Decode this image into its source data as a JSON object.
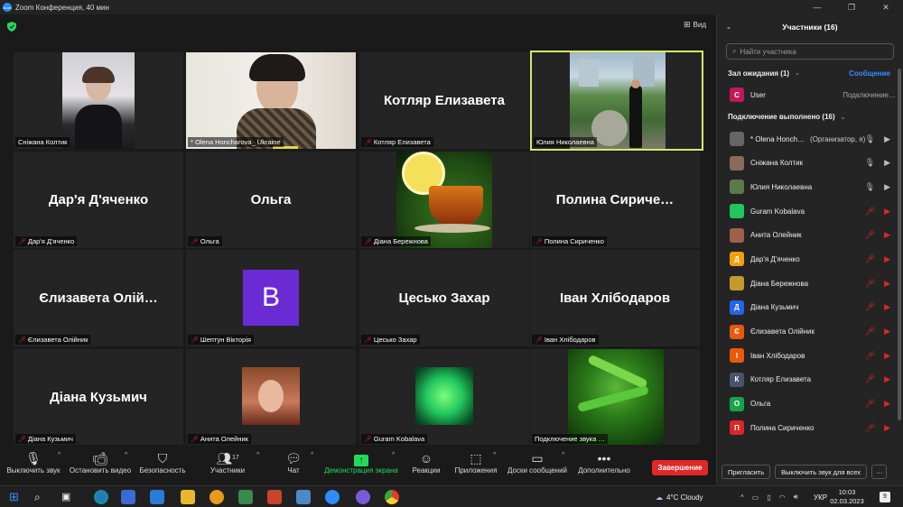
{
  "window": {
    "title": "Zoom Конференция, 40 мин"
  },
  "view_button": {
    "label": "Вид"
  },
  "tiles": [
    {
      "name": "Сніжана Колтик",
      "big": "",
      "muted": false
    },
    {
      "name": "* Olena Honcharova_ Ukraine",
      "big": "",
      "muted": false
    },
    {
      "name": "Котляр Елизавета",
      "big": "Котляр Елизавета",
      "muted": true
    },
    {
      "name": "Юлия Николаевна",
      "big": "",
      "muted": false
    },
    {
      "name": "Дар'я Д'яченко",
      "big": "Дар'я Д'яченко",
      "muted": true
    },
    {
      "name": "Ольга",
      "big": "Ольга",
      "muted": true
    },
    {
      "name": "Діана Бережнова",
      "big": "",
      "muted": true
    },
    {
      "name": "Полина Сириченко",
      "big": "Полина  Сириче…",
      "muted": true
    },
    {
      "name": "Єлизавета Олійник",
      "big": "Єлизавета  Олій…",
      "muted": true
    },
    {
      "name": "Шептун Вікторія",
      "big": "",
      "muted": true,
      "avatar_letter": "B"
    },
    {
      "name": "Цесько Захар",
      "big": "Цесько Захар",
      "muted": true
    },
    {
      "name": "Іван Хлібодаров",
      "big": "Іван Хлібодаров",
      "muted": true
    },
    {
      "name": "Діана Кузьмич",
      "big": "Діана Кузьмич",
      "muted": true
    },
    {
      "name": "Анита Олейник",
      "big": "",
      "muted": true
    },
    {
      "name": "Guram Kobalava",
      "big": "",
      "muted": true
    },
    {
      "name": "Подключение звука …",
      "big": "",
      "muted": false
    }
  ],
  "toolbar": {
    "mute": "Выключить звук",
    "video": "Остановить видео",
    "security": "Безопасность",
    "participants": "Участники",
    "participants_count": "17",
    "chat": "Чат",
    "share": "Демонстрация экрана",
    "reactions": "Реакции",
    "apps": "Приложения",
    "whiteboards": "Доски сообщений",
    "more": "Дополнительно",
    "end": "Завершение"
  },
  "sidebar": {
    "title": "Участники (16)",
    "search_placeholder": "Найти участника",
    "waiting_room": "Зал ожидания (1)",
    "message_btn": "Сообщение",
    "waiting_user": {
      "name": "User",
      "status": "Подключение…",
      "letter": "C",
      "color": "#c2185b"
    },
    "connected": "Подключение выполнено (16)",
    "participants": [
      {
        "name": "* Olena Honch…",
        "role": "(Организатор, я)",
        "letter": "",
        "color": "#666",
        "mic": "on"
      },
      {
        "name": "Сніжана Колтик",
        "role": "",
        "letter": "",
        "color": "#8a6a5a",
        "mic": "on"
      },
      {
        "name": "Юлия Николаевна",
        "role": "",
        "letter": "",
        "color": "#5a7a4a",
        "mic": "on"
      },
      {
        "name": "Guram Kobalava",
        "role": "",
        "letter": "",
        "color": "#22c55e",
        "mic": "off"
      },
      {
        "name": "Анита Олейник",
        "role": "",
        "letter": "",
        "color": "#a0604a",
        "mic": "off"
      },
      {
        "name": "Дар'я Д'яченко",
        "role": "",
        "letter": "Д",
        "color": "#f59e0b",
        "mic": "off"
      },
      {
        "name": "Діана Бережнова",
        "role": "",
        "letter": "",
        "color": "#c49a2a",
        "mic": "off"
      },
      {
        "name": "Діана Кузьмич",
        "role": "",
        "letter": "Д",
        "color": "#2563eb",
        "mic": "off"
      },
      {
        "name": "Єлизавета Олійник",
        "role": "",
        "letter": "Є",
        "color": "#ea580c",
        "mic": "off"
      },
      {
        "name": "Іван Хлібодаров",
        "role": "",
        "letter": "І",
        "color": "#ea580c",
        "mic": "off"
      },
      {
        "name": "Котляр Елизавета",
        "role": "",
        "letter": "К",
        "color": "#475569",
        "mic": "off"
      },
      {
        "name": "Ольга",
        "role": "",
        "letter": "О",
        "color": "#16a34a",
        "mic": "off"
      },
      {
        "name": "Полина Сириченко",
        "role": "",
        "letter": "П",
        "color": "#dc2626",
        "mic": "off"
      }
    ],
    "invite": "Пригласить",
    "mute_all": "Выключить звук для всех",
    "more": "···"
  },
  "taskbar": {
    "weather": "4°C  Cloudy",
    "lang": "УКР",
    "time": "10:03",
    "date": "02.03.2023",
    "notifications": "9"
  }
}
